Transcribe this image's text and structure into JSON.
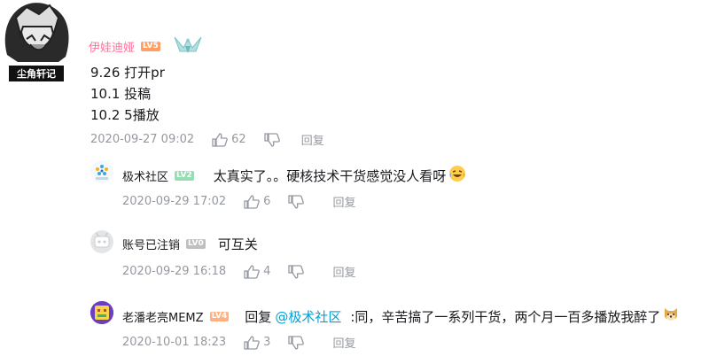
{
  "root": {
    "username": "伊娃迪娅",
    "level": "LV5",
    "avatar_text": "尘角轩记",
    "lines": [
      "9.26 打开pr",
      "10.1 投稿",
      "10.2 5播放"
    ],
    "timestamp": "2020-09-27 09:02",
    "likes": "62",
    "reply_label": "回复"
  },
  "replies": [
    {
      "username": "极术社区",
      "level": "LV2",
      "avatar_text": "极术社区",
      "text": "太真实了。。硬核技术干货感觉没人看呀",
      "emoji": "laughing-tears",
      "timestamp": "2020-09-29 17:02",
      "likes": "6",
      "reply_label": "回复"
    },
    {
      "username": "账号已注销",
      "level": "LV0",
      "text": "可互关",
      "timestamp": "2020-09-29 16:18",
      "likes": "4",
      "reply_label": "回复"
    },
    {
      "username": "老潘老亮MEMZ",
      "level": "LV4",
      "prefix": "回复",
      "mention": "@极术社区",
      "text": ":同，辛苦搞了一系列干货，两个月一百多播放我醉了",
      "emoji": "dog-face",
      "timestamp": "2020-10-01 18:23",
      "likes": "3",
      "reply_label": "回复"
    }
  ],
  "colors": {
    "username_pink": "#fb7299",
    "lv5": "#ff9f63",
    "lv2": "#95ddb2",
    "lv0": "#bfbfbf",
    "lv4": "#ffb27f",
    "meta_gray": "#9499a0",
    "mention_blue": "#00a1d6"
  }
}
